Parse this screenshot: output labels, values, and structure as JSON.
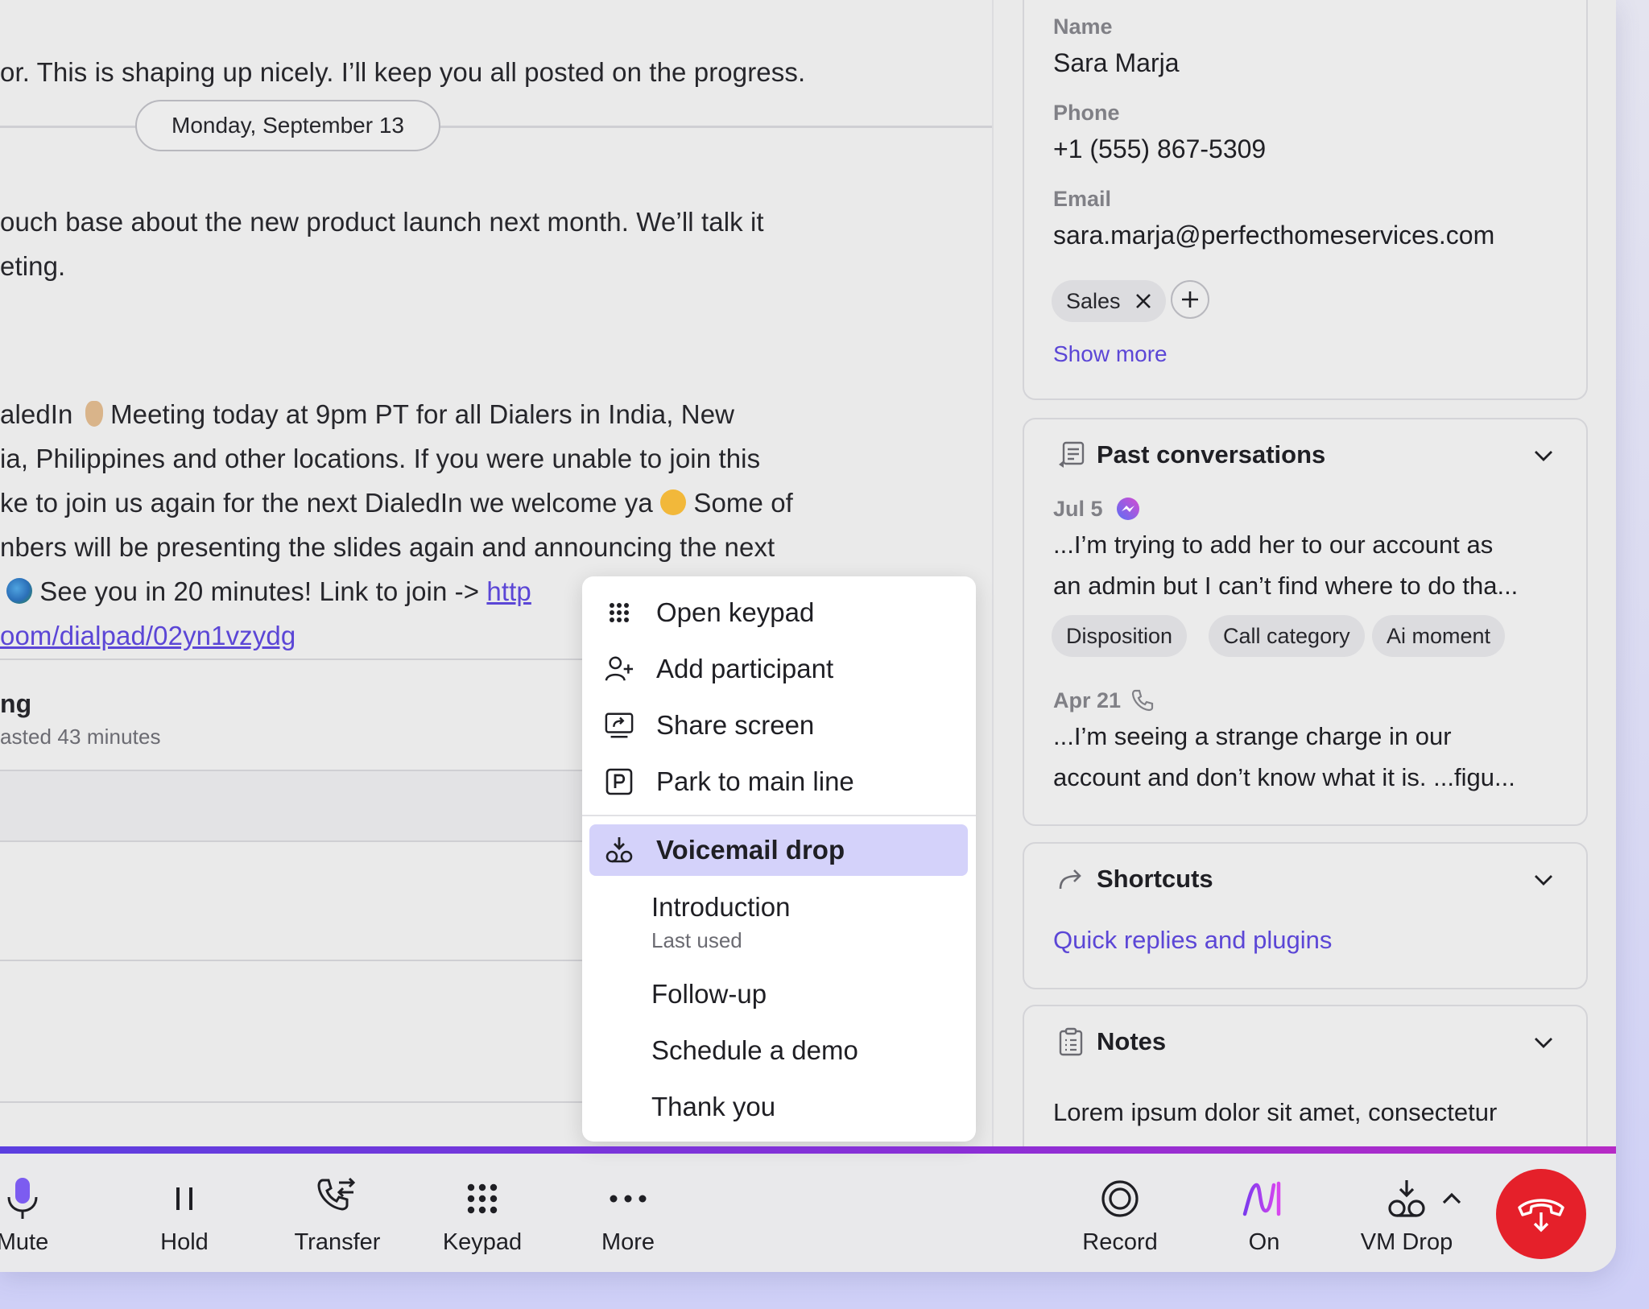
{
  "chat": {
    "line1": "or. This is shaping up nicely. I’ll keep you all posted on the progress.",
    "date_divider": "Monday, September 13",
    "line2": "ouch base about the new product launch next month. We’ll talk it",
    "line3": "eting.",
    "line4a": "aledIn",
    "line4b": " Meeting today at 9pm PT for all Dialers in India, New",
    "line5": "ia, Philippines and other locations.  If you were unable to join this",
    "line6a": "ke to join us again for the next DialedIn we welcome ya",
    "line6b": " Some of",
    "line7": "nbers will be presenting the slides again and announcing the next",
    "line8a": " See you in 20 minutes! Link to join -> ",
    "line8_link": "http",
    "line9_link": "oom/dialpad/02yn1vzydg",
    "call_title": "ng",
    "call_subtitle": "asted 43 minutes"
  },
  "menu": {
    "items": [
      {
        "label": "Open keypad",
        "icon": "keypad-icon"
      },
      {
        "label": "Add participant",
        "icon": "add-person-icon"
      },
      {
        "label": "Share screen",
        "icon": "share-screen-icon"
      },
      {
        "label": "Park to main line",
        "icon": "parking-icon"
      }
    ],
    "section_title": "Voicemail drop",
    "section_icon": "voicemail-drop-icon",
    "voicemails": [
      {
        "label": "Introduction",
        "sub": "Last used"
      },
      {
        "label": "Follow-up"
      },
      {
        "label": "Schedule a demo"
      },
      {
        "label": "Thank you"
      }
    ]
  },
  "contact": {
    "name_label": "Name",
    "name": "Sara Marja",
    "phone_label": "Phone",
    "phone": "+1 (555) 867-5309",
    "email_label": "Email",
    "email": "sara.marja@perfecthomeservices.com",
    "tag": "Sales",
    "show_more": "Show more"
  },
  "past_conversations": {
    "title": "Past conversations",
    "items": [
      {
        "date": "Jul 5",
        "channel_icon": "messenger-icon",
        "text_line1": "...I’m trying to add her to our account as",
        "text_line2": "an admin but I can’t find where to do tha..."
      },
      {
        "date": "Apr 21",
        "channel_icon": "phone-icon",
        "text_line1": "...I’m seeing a strange charge in our",
        "text_line2": "account and don’t know what it is. ...figu..."
      }
    ],
    "tags": [
      "Disposition",
      "Call category",
      "Ai moment"
    ]
  },
  "shortcuts": {
    "title": "Shortcuts",
    "link": "Quick replies and plugins"
  },
  "notes": {
    "title": "Notes",
    "text": "Lorem ipsum dolor sit amet, consectetur"
  },
  "bottom_bar": {
    "mute": "Mute",
    "hold": "Hold",
    "transfer": "Transfer",
    "keypad": "Keypad",
    "more": "More",
    "record": "Record",
    "ai": "On",
    "vm_drop": "VM Drop"
  },
  "colors": {
    "accent": "#5b46d6",
    "highlight": "#d4d2fa",
    "hangup": "#e5202a",
    "bar_gradient_start": "#5b3fe0",
    "bar_gradient_end": "#b62bc6"
  }
}
